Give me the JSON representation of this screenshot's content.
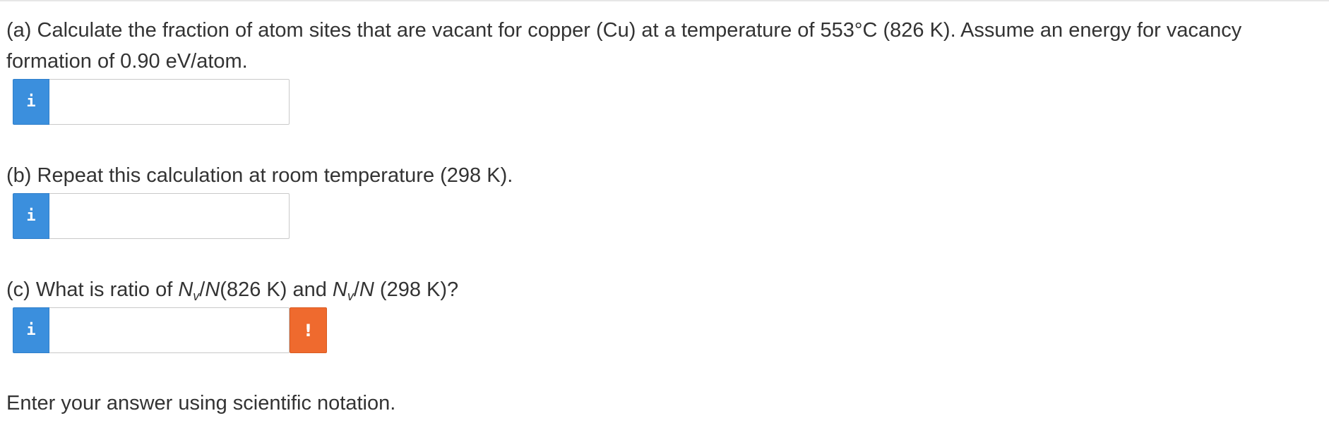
{
  "questions": {
    "a": {
      "text": "(a) Calculate the fraction of atom sites that are vacant for copper (Cu) at a temperature of 553°C (826 K). Assume an energy for vacancy formation of 0.90 eV/atom.",
      "input_value": "",
      "info_icon": "info-icon"
    },
    "b": {
      "text": "(b) Repeat this calculation at room temperature (298 K).",
      "input_value": "",
      "info_icon": "info-icon"
    },
    "c": {
      "prefix": "(c) What is ratio of ",
      "n1": "N",
      "sub1": "v",
      "mid1": "/",
      "n2": "N",
      "mid2": "(826 K) and ",
      "n3": "N",
      "sub2": "v",
      "mid3": "/",
      "n4": "N",
      "suffix": " (298 K)?",
      "input_value": "",
      "info_icon": "info-icon",
      "warning_icon": "exclamation-icon",
      "warning_glyph": "!"
    }
  },
  "note": "Enter your answer using scientific notation.",
  "icons": {
    "info_glyph": "i"
  },
  "colors": {
    "info_badge": "#3b8fdd",
    "warning_badge": "#ef6a2e",
    "text": "#333333",
    "input_border": "#c9c9c9"
  }
}
